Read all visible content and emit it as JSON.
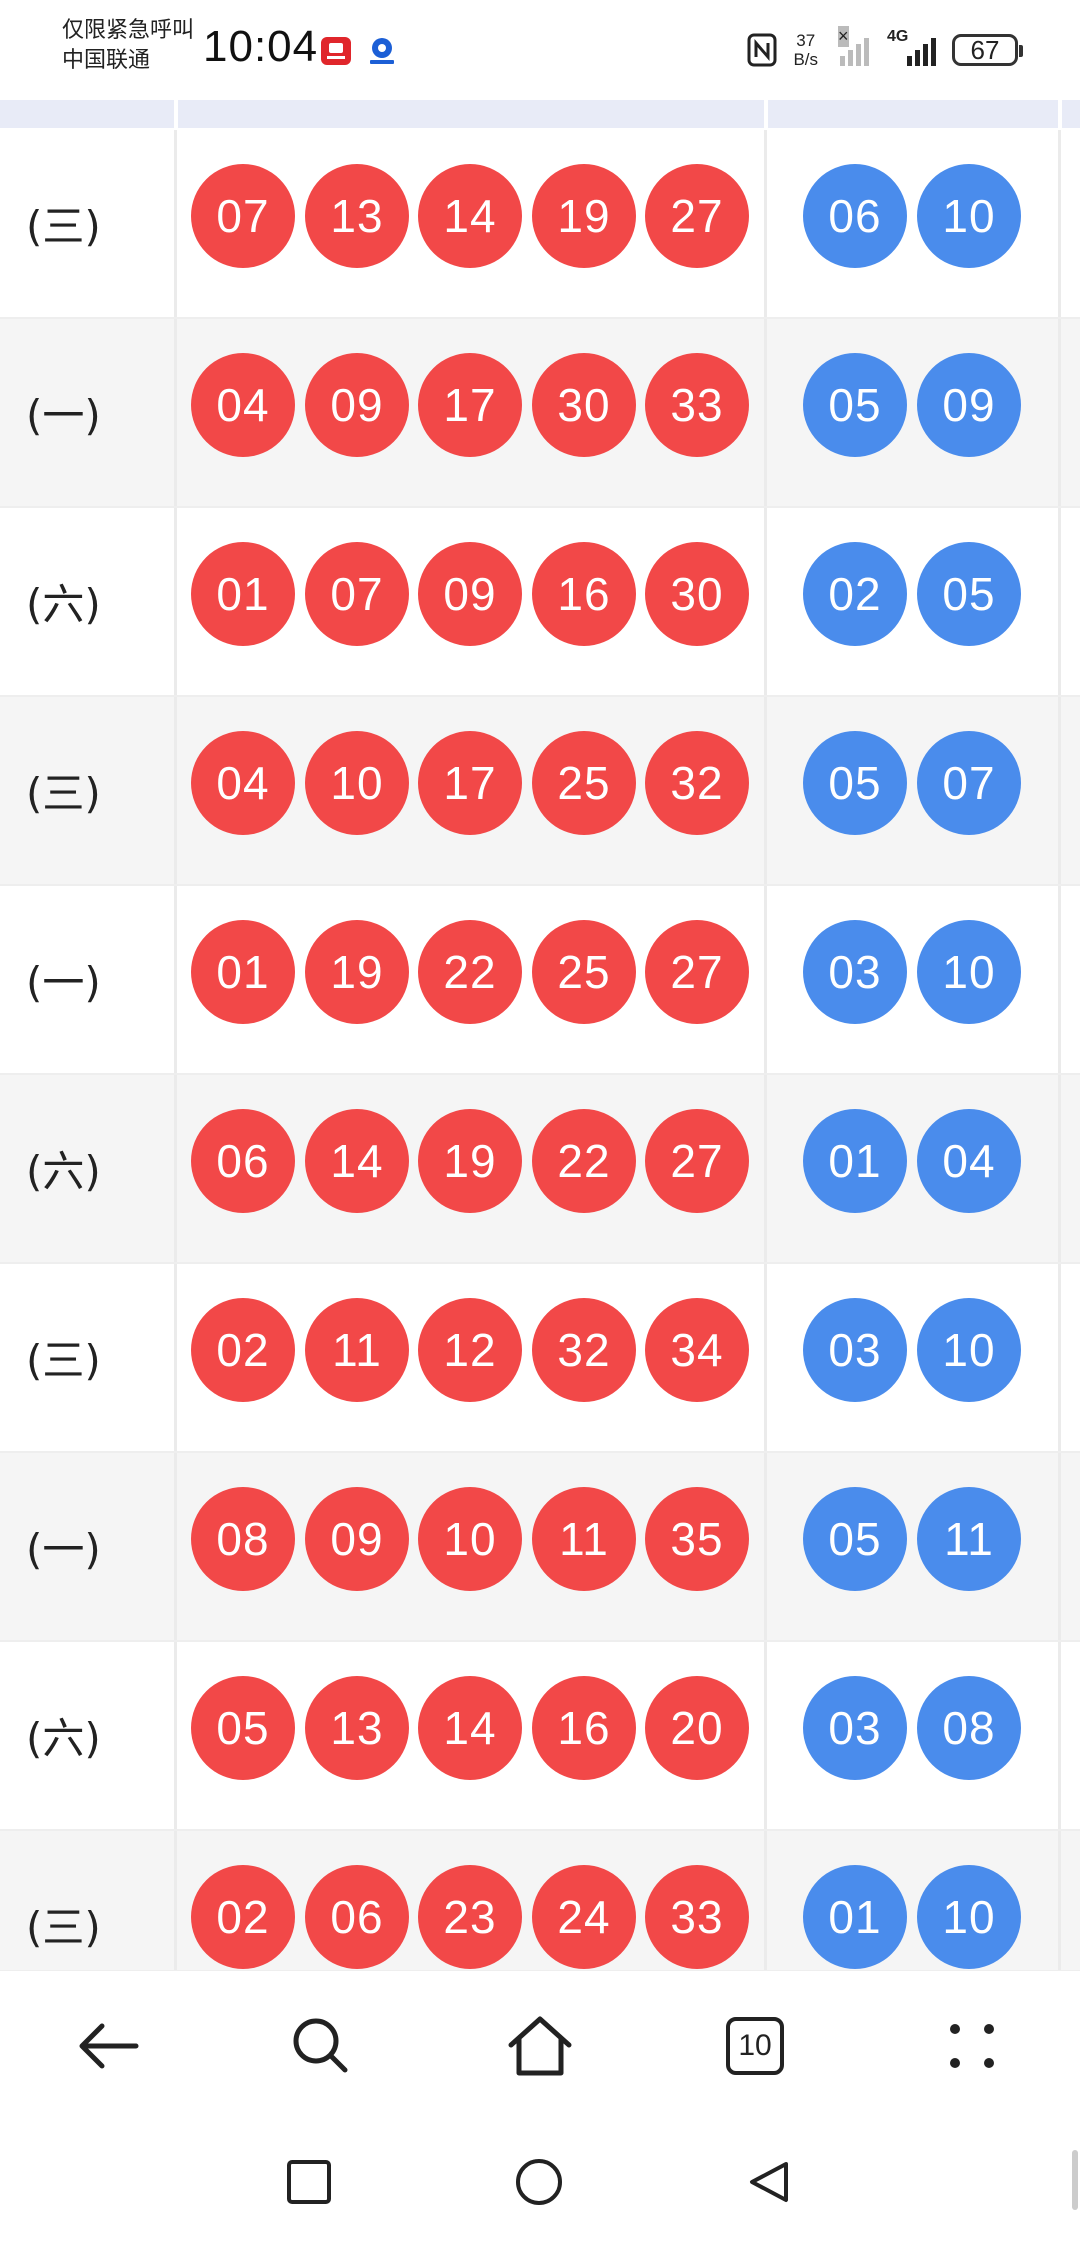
{
  "status_bar": {
    "carrier_line1": "仅限紧急呼叫",
    "carrier_line2": "中国联通",
    "time": "10:04",
    "net_speed_value": "37",
    "net_speed_unit": "B/s",
    "network_type": "4G",
    "battery": "67",
    "notification_icons": [
      "app-notification-icon",
      "app-notification-icon"
    ]
  },
  "draws": [
    {
      "weekday": "(三)",
      "red": [
        "07",
        "13",
        "14",
        "19",
        "27"
      ],
      "blue": [
        "06",
        "10"
      ]
    },
    {
      "weekday": "(一)",
      "red": [
        "04",
        "09",
        "17",
        "30",
        "33"
      ],
      "blue": [
        "05",
        "09"
      ]
    },
    {
      "weekday": "(六)",
      "red": [
        "01",
        "07",
        "09",
        "16",
        "30"
      ],
      "blue": [
        "02",
        "05"
      ]
    },
    {
      "weekday": "(三)",
      "red": [
        "04",
        "10",
        "17",
        "25",
        "32"
      ],
      "blue": [
        "05",
        "07"
      ]
    },
    {
      "weekday": "(一)",
      "red": [
        "01",
        "19",
        "22",
        "25",
        "27"
      ],
      "blue": [
        "03",
        "10"
      ]
    },
    {
      "weekday": "(六)",
      "red": [
        "06",
        "14",
        "19",
        "22",
        "27"
      ],
      "blue": [
        "01",
        "04"
      ]
    },
    {
      "weekday": "(三)",
      "red": [
        "02",
        "11",
        "12",
        "32",
        "34"
      ],
      "blue": [
        "03",
        "10"
      ]
    },
    {
      "weekday": "(一)",
      "red": [
        "08",
        "09",
        "10",
        "11",
        "35"
      ],
      "blue": [
        "05",
        "11"
      ]
    },
    {
      "weekday": "(六)",
      "red": [
        "05",
        "13",
        "14",
        "16",
        "20"
      ],
      "blue": [
        "03",
        "08"
      ]
    },
    {
      "weekday": "(三)",
      "red": [
        "02",
        "06",
        "23",
        "24",
        "33"
      ],
      "blue": [
        "01",
        "10"
      ]
    }
  ],
  "toolbar": {
    "tab_count": "10",
    "icons": [
      "back-arrow-icon",
      "search-icon",
      "home-icon",
      "tabs-icon",
      "more-dots-icon"
    ]
  },
  "system_nav": {
    "icons": [
      "recents-square-icon",
      "home-circle-icon",
      "back-triangle-icon"
    ]
  },
  "colors": {
    "red_ball": "#f24848",
    "blue_ball": "#4a8cec",
    "header_strip": "#e8ebf7",
    "row_alt": "#f5f5f5"
  }
}
